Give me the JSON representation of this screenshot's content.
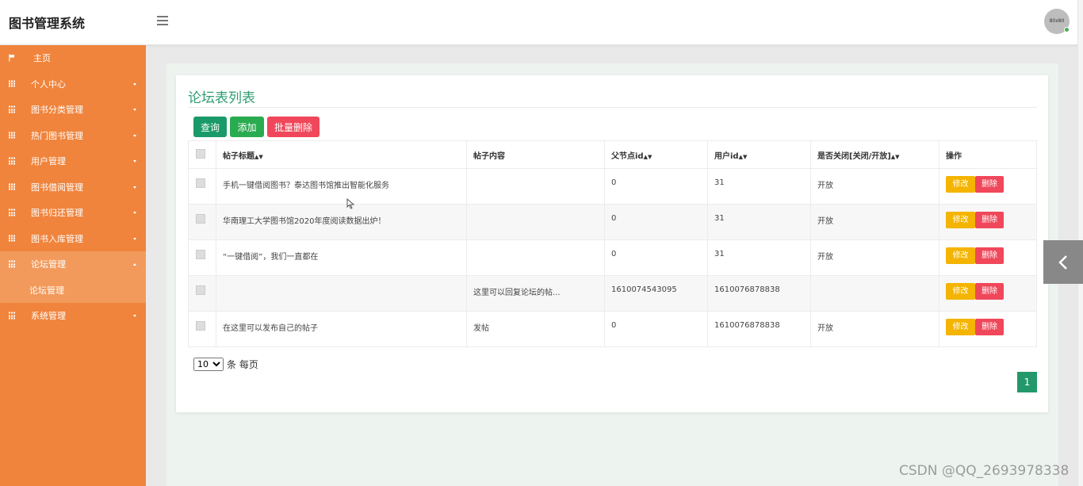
{
  "app": {
    "title": "图书管理系统",
    "avatar_text": "80x80"
  },
  "sidebar": {
    "items": [
      {
        "label": "主页"
      },
      {
        "label": "个人中心"
      },
      {
        "label": "图书分类管理"
      },
      {
        "label": "热门图书管理"
      },
      {
        "label": "用户管理"
      },
      {
        "label": "图书借阅管理"
      },
      {
        "label": "图书归还管理"
      },
      {
        "label": "图书入库管理"
      },
      {
        "label": "论坛管理"
      },
      {
        "label": "系统管理"
      }
    ],
    "sub_item": "论坛管理"
  },
  "page": {
    "title": "论坛表列表",
    "buttons": {
      "query": "查询",
      "add": "添加",
      "batch_delete": "批量删除"
    }
  },
  "table": {
    "headers": [
      "帖子标题",
      "帖子内容",
      "父节点id",
      "用户id",
      "是否关闭[关闭/开放]",
      "操作"
    ],
    "rows": [
      {
        "title": "手机一键借阅图书？泰达图书馆推出智能化服务",
        "content": "",
        "parent_id": "0",
        "user_id": "31",
        "closed": "开放"
      },
      {
        "title": "华南理工大学图书馆2020年度阅读数据出炉！",
        "content": "",
        "parent_id": "0",
        "user_id": "31",
        "closed": "开放"
      },
      {
        "title": "“一键借阅”，我们一直都在",
        "content": "",
        "parent_id": "0",
        "user_id": "31",
        "closed": "开放"
      },
      {
        "title": "",
        "content": "这里可以回复论坛的帖...",
        "parent_id": "1610074543095",
        "user_id": "1610076878838",
        "closed": ""
      },
      {
        "title": "在这里可以发布自己的帖子",
        "content": "发帖",
        "parent_id": "0",
        "user_id": "1610076878838",
        "closed": "开放"
      }
    ],
    "edit_label": "修改",
    "delete_label": "删除"
  },
  "pagination": {
    "page_size": "10",
    "per_page_label": "条 每页",
    "current_page": "1"
  },
  "watermark": "CSDN @QQ_2693978338"
}
